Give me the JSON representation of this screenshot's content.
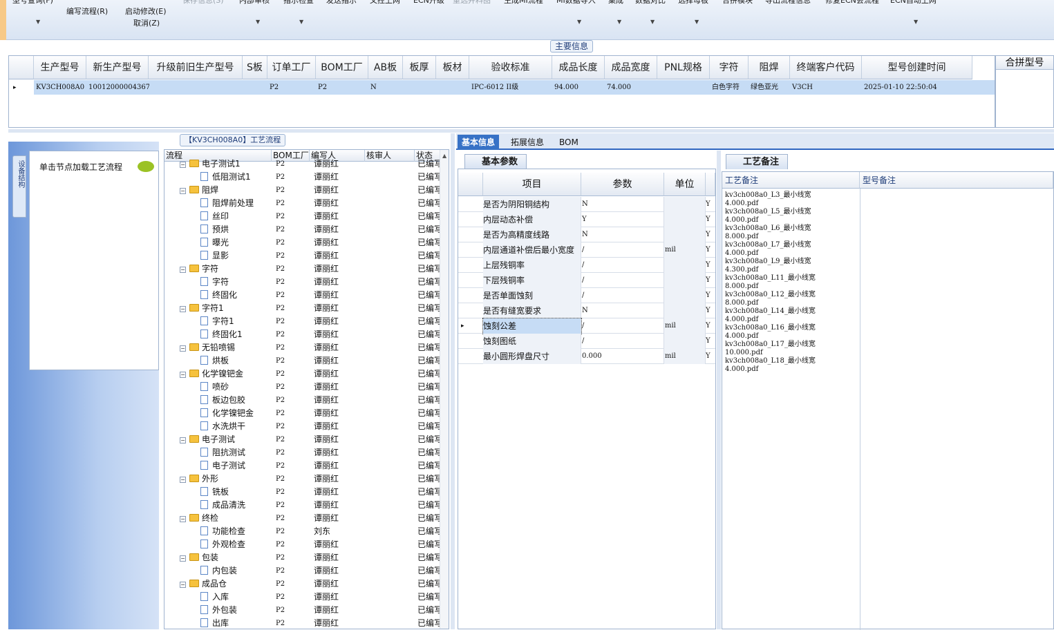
{
  "ribbon": {
    "top_items": [
      {
        "label": "型号查询(F)",
        "disabled": false
      },
      {
        "label": "保存信息(S)",
        "disabled": true
      },
      {
        "label": "内部审核",
        "disabled": false
      },
      {
        "label": "指示检查",
        "disabled": false
      },
      {
        "label": "发送指示",
        "disabled": false
      },
      {
        "label": "文控上网",
        "disabled": false
      },
      {
        "label": "ECN升级",
        "disabled": false
      },
      {
        "label": "重选并料图",
        "disabled": true
      },
      {
        "label": "生成MI流程",
        "disabled": false
      },
      {
        "label": "MI数据导入",
        "disabled": false
      },
      {
        "label": "集成",
        "disabled": false
      },
      {
        "label": "数据对比",
        "disabled": false
      },
      {
        "label": "选择母板",
        "disabled": false
      },
      {
        "label": "合拼模块",
        "disabled": false
      },
      {
        "label": "导出流程信息",
        "disabled": false
      },
      {
        "label": "修复ECN会流程",
        "disabled": false
      },
      {
        "label": "ECN自动上网",
        "disabled": false
      }
    ],
    "edit_flow": "编写流程(R)",
    "start_modify": "启动修改(E)",
    "cancel": "取消(Z)"
  },
  "main_info": {
    "section_label": "主要信息",
    "columns": [
      "生产型号",
      "新生产型号",
      "升级前旧生产型号",
      "S板",
      "订单工厂",
      "BOM工厂",
      "AB板",
      "板厚",
      "板材",
      "验收标准",
      "成品长度",
      "成品宽度",
      "PNL规格",
      "字符",
      "阻焊",
      "终端客户代码",
      "型号创建时间"
    ],
    "row": [
      "KV3CH008A0",
      "10012000004367",
      "",
      "",
      "P2",
      "P2",
      "N",
      "",
      "",
      "IPC-6012 II级",
      "94.000",
      "74.000",
      "",
      "白色字符",
      "绿色亚光",
      "V3CH",
      "2025-01-10 22:50:04"
    ],
    "merge_label": "合拼型号"
  },
  "flow": {
    "title": "【KV3CH008A0】工艺流程",
    "side_tab": "设备结构",
    "hint": "单击节点加载工艺流程",
    "columns": [
      "流程",
      "BOM工厂",
      "编写人",
      "核审人",
      "状态"
    ],
    "rows": [
      {
        "name": "电子测试1",
        "level": 0,
        "factory": "P2",
        "writer": "谭丽红",
        "status": "已编写"
      },
      {
        "name": "低阻测试1",
        "level": 1,
        "factory": "P2",
        "writer": "谭丽红",
        "status": "已编写"
      },
      {
        "name": "阻焊",
        "level": 0,
        "factory": "P2",
        "writer": "谭丽红",
        "status": "已编写"
      },
      {
        "name": "阻焊前处理",
        "level": 1,
        "factory": "P2",
        "writer": "谭丽红",
        "status": "已编写"
      },
      {
        "name": "丝印",
        "level": 1,
        "factory": "P2",
        "writer": "谭丽红",
        "status": "已编写"
      },
      {
        "name": "预烘",
        "level": 1,
        "factory": "P2",
        "writer": "谭丽红",
        "status": "已编写"
      },
      {
        "name": "曝光",
        "level": 1,
        "factory": "P2",
        "writer": "谭丽红",
        "status": "已编写"
      },
      {
        "name": "显影",
        "level": 1,
        "factory": "P2",
        "writer": "谭丽红",
        "status": "已编写"
      },
      {
        "name": "字符",
        "level": 0,
        "factory": "P2",
        "writer": "谭丽红",
        "status": "已编写"
      },
      {
        "name": "字符",
        "level": 1,
        "factory": "P2",
        "writer": "谭丽红",
        "status": "已编写"
      },
      {
        "name": "终固化",
        "level": 1,
        "factory": "P2",
        "writer": "谭丽红",
        "status": "已编写"
      },
      {
        "name": "字符1",
        "level": 0,
        "factory": "P2",
        "writer": "谭丽红",
        "status": "已编写"
      },
      {
        "name": "字符1",
        "level": 1,
        "factory": "P2",
        "writer": "谭丽红",
        "status": "已编写"
      },
      {
        "name": "终固化1",
        "level": 1,
        "factory": "P2",
        "writer": "谭丽红",
        "status": "已编写"
      },
      {
        "name": "无铅喷锡",
        "level": 0,
        "factory": "P2",
        "writer": "谭丽红",
        "status": "已编写"
      },
      {
        "name": "烘板",
        "level": 1,
        "factory": "P2",
        "writer": "谭丽红",
        "status": "已编写"
      },
      {
        "name": "化学镍钯金",
        "level": 0,
        "factory": "P2",
        "writer": "谭丽红",
        "status": "已编写"
      },
      {
        "name": "喷砂",
        "level": 1,
        "factory": "P2",
        "writer": "谭丽红",
        "status": "已编写"
      },
      {
        "name": "板边包胶",
        "level": 1,
        "factory": "P2",
        "writer": "谭丽红",
        "status": "已编写"
      },
      {
        "name": "化学镍钯金",
        "level": 1,
        "factory": "P2",
        "writer": "谭丽红",
        "status": "已编写"
      },
      {
        "name": "水洗烘干",
        "level": 1,
        "factory": "P2",
        "writer": "谭丽红",
        "status": "已编写"
      },
      {
        "name": "电子测试",
        "level": 0,
        "factory": "P2",
        "writer": "谭丽红",
        "status": "已编写"
      },
      {
        "name": "阻抗测试",
        "level": 1,
        "factory": "P2",
        "writer": "谭丽红",
        "status": "已编写"
      },
      {
        "name": "电子测试",
        "level": 1,
        "factory": "P2",
        "writer": "谭丽红",
        "status": "已编写"
      },
      {
        "name": "外形",
        "level": 0,
        "factory": "P2",
        "writer": "谭丽红",
        "status": "已编写"
      },
      {
        "name": "铣板",
        "level": 1,
        "factory": "P2",
        "writer": "谭丽红",
        "status": "已编写"
      },
      {
        "name": "成品清洗",
        "level": 1,
        "factory": "P2",
        "writer": "谭丽红",
        "status": "已编写"
      },
      {
        "name": "终检",
        "level": 0,
        "factory": "P2",
        "writer": "谭丽红",
        "status": "已编写"
      },
      {
        "name": "功能检查",
        "level": 1,
        "factory": "P2",
        "writer": "刘东",
        "status": "已编写"
      },
      {
        "name": "外观检查",
        "level": 1,
        "factory": "P2",
        "writer": "谭丽红",
        "status": "已编写"
      },
      {
        "name": "包装",
        "level": 0,
        "factory": "P2",
        "writer": "谭丽红",
        "status": "已编写"
      },
      {
        "name": "内包装",
        "level": 1,
        "factory": "P2",
        "writer": "谭丽红",
        "status": "已编写"
      },
      {
        "name": "成品仓",
        "level": 0,
        "factory": "P2",
        "writer": "谭丽红",
        "status": "已编写"
      },
      {
        "name": "入库",
        "level": 1,
        "factory": "P2",
        "writer": "谭丽红",
        "status": "已编写"
      },
      {
        "name": "外包装",
        "level": 1,
        "factory": "P2",
        "writer": "谭丽红",
        "status": "已编写"
      },
      {
        "name": "出库",
        "level": 1,
        "factory": "P2",
        "writer": "谭丽红",
        "status": "已编写"
      }
    ]
  },
  "detail_tabs": [
    "基本信息",
    "拓展信息",
    "BOM"
  ],
  "basic_params": {
    "tab_label": "基本参数",
    "columns": [
      "项目",
      "参数",
      "单位"
    ],
    "rows": [
      {
        "item": "是否为阴阳铜结构",
        "value": "N",
        "unit": "",
        "flag": "Y"
      },
      {
        "item": "内层动态补偿",
        "value": "Y",
        "unit": "",
        "flag": "Y"
      },
      {
        "item": "是否为高精度线路",
        "value": "N",
        "unit": "",
        "flag": "Y"
      },
      {
        "item": "内层通道补偿后最小宽度",
        "value": "/",
        "unit": "mil",
        "flag": "Y"
      },
      {
        "item": "上层残铜率",
        "value": "/",
        "unit": "",
        "flag": "Y"
      },
      {
        "item": "下层残铜率",
        "value": "/",
        "unit": "",
        "flag": "Y"
      },
      {
        "item": "是否单面蚀刻",
        "value": "/",
        "unit": "",
        "flag": "Y"
      },
      {
        "item": "是否有缝宽要求",
        "value": "N",
        "unit": "",
        "flag": "Y"
      },
      {
        "item": "蚀刻公差",
        "value": "/",
        "unit": "mil",
        "flag": "Y"
      },
      {
        "item": "蚀刻图纸",
        "value": "/",
        "unit": "",
        "flag": "Y"
      },
      {
        "item": "最小圆形焊盘尺寸",
        "value": "0.000",
        "unit": "mil",
        "flag": "Y"
      }
    ]
  },
  "notes": {
    "tab_label": "工艺备注",
    "col1": "工艺备注",
    "col2": "型号备注",
    "text": "kv3ch008a0_L3_最小线宽\n4.000.pdf\nkv3ch008a0_L5_最小线宽\n4.000.pdf\nkv3ch008a0_L6_最小线宽\n8.000.pdf\nkv3ch008a0_L7_最小线宽\n4.000.pdf\nkv3ch008a0_L9_最小线宽\n4.300.pdf\nkv3ch008a0_L11_最小线宽\n8.000.pdf\nkv3ch008a0_L12_最小线宽\n8.000.pdf\nkv3ch008a0_L14_最小线宽\n4.000.pdf\nkv3ch008a0_L16_最小线宽\n4.000.pdf\nkv3ch008a0_L17_最小线宽\n10.000.pdf\nkv3ch008a0_L18_最小线宽\n4.000.pdf"
  },
  "colors": {
    "accent": "#3772c6",
    "selection": "#c6dcf5",
    "folder": "#f6c23d"
  }
}
